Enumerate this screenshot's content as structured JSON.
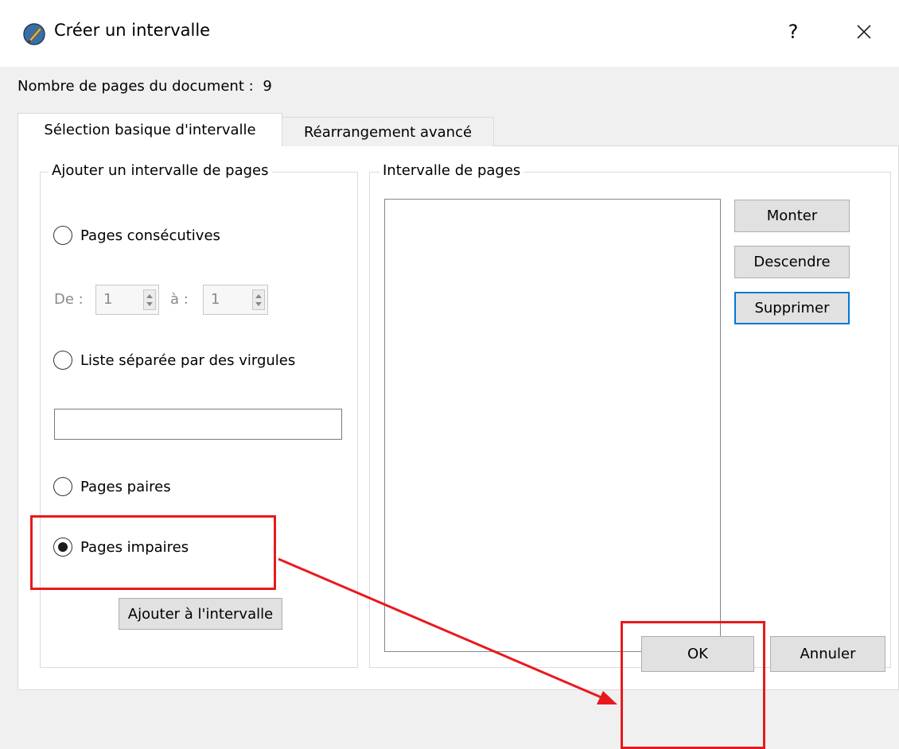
{
  "window": {
    "title": "Créer un intervalle",
    "help_label": "?",
    "icons": {
      "app": "app-logo-icon",
      "help": "help-icon",
      "close": "close-icon"
    }
  },
  "document_info": {
    "pages_label": "Nombre de pages du document :",
    "pages_count": "9"
  },
  "tabs": [
    {
      "label": "Sélection basique d'intervalle",
      "active": true
    },
    {
      "label": "Réarrangement avancé",
      "active": false
    }
  ],
  "add_group": {
    "legend": "Ajouter un intervalle de pages",
    "options": {
      "consecutive": {
        "label": "Pages consécutives",
        "checked": false
      },
      "comma_list": {
        "label": "Liste séparée par des virgules",
        "checked": false
      },
      "even": {
        "label": "Pages paires",
        "checked": false
      },
      "odd": {
        "label": "Pages impaires",
        "checked": true
      }
    },
    "from_label": "De :",
    "from_value": "1",
    "to_label": "à :",
    "to_value": "1",
    "comma_list_value": "",
    "add_button": "Ajouter à l'intervalle"
  },
  "range_group": {
    "legend": "Intervalle de pages",
    "items": [],
    "up_button": "Monter",
    "down_button": "Descendre",
    "delete_button": "Supprimer"
  },
  "footer": {
    "ok_button": "OK",
    "cancel_button": "Annuler"
  },
  "annotation": {
    "color": "#e8191d"
  }
}
